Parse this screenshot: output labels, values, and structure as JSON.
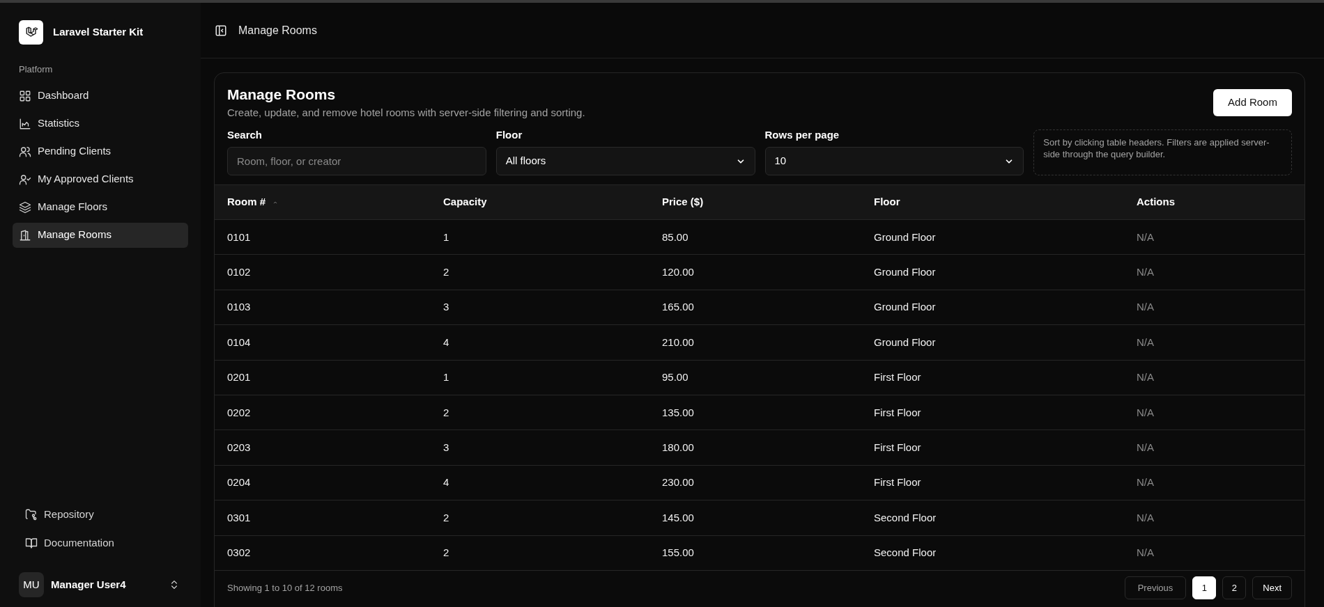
{
  "sidebar": {
    "brand": "Laravel Starter Kit",
    "section_label": "Platform",
    "nav": [
      {
        "label": "Dashboard",
        "selected": false
      },
      {
        "label": "Statistics",
        "selected": false
      },
      {
        "label": "Pending Clients",
        "selected": false
      },
      {
        "label": "My Approved Clients",
        "selected": false
      },
      {
        "label": "Manage Floors",
        "selected": false
      },
      {
        "label": "Manage Rooms",
        "selected": true
      }
    ],
    "footer_links": [
      {
        "label": "Repository"
      },
      {
        "label": "Documentation"
      }
    ],
    "user": {
      "initials": "MU",
      "name": "Manager User4"
    }
  },
  "header": {
    "title": "Manage Rooms"
  },
  "card": {
    "title": "Manage Rooms",
    "subtitle": "Create, update, and remove hotel rooms with server-side filtering and sorting.",
    "add_button": "Add Room",
    "filters": [
      {
        "kind": "input",
        "label": "Search",
        "placeholder": "Room, floor, or creator"
      },
      {
        "kind": "select",
        "label": "Floor",
        "value": "All floors"
      },
      {
        "kind": "select",
        "label": "Rows per page",
        "value": "10"
      }
    ],
    "note": "Sort by clicking table headers. Filters are applied server-side through the query builder."
  },
  "table": {
    "columns": [
      {
        "label": "Room #",
        "sorted": true
      },
      {
        "label": "Capacity",
        "sorted": false
      },
      {
        "label": "Price ($)",
        "sorted": false
      },
      {
        "label": "Floor",
        "sorted": false
      },
      {
        "label": "Actions",
        "sorted": false
      }
    ],
    "rows": [
      [
        "0101",
        "1",
        "85.00",
        "Ground Floor",
        "N/A"
      ],
      [
        "0102",
        "2",
        "120.00",
        "Ground Floor",
        "N/A"
      ],
      [
        "0103",
        "3",
        "165.00",
        "Ground Floor",
        "N/A"
      ],
      [
        "0104",
        "4",
        "210.00",
        "Ground Floor",
        "N/A"
      ],
      [
        "0201",
        "1",
        "95.00",
        "First Floor",
        "N/A"
      ],
      [
        "0202",
        "2",
        "135.00",
        "First Floor",
        "N/A"
      ],
      [
        "0203",
        "3",
        "180.00",
        "First Floor",
        "N/A"
      ],
      [
        "0204",
        "4",
        "230.00",
        "First Floor",
        "N/A"
      ],
      [
        "0301",
        "2",
        "145.00",
        "Second Floor",
        "N/A"
      ],
      [
        "0302",
        "2",
        "155.00",
        "Second Floor",
        "N/A"
      ]
    ]
  },
  "footer": {
    "summary": "Showing 1 to 10 of 12 rooms",
    "previous": "Previous",
    "pages": [
      {
        "label": "1",
        "selected": true
      },
      {
        "label": "2",
        "selected": false
      }
    ],
    "next": "Next"
  }
}
